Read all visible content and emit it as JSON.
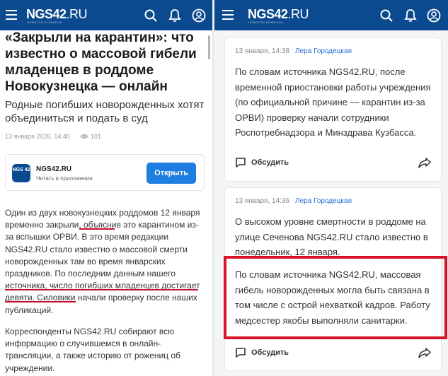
{
  "left": {
    "header": {
      "logo_main": "NGS42",
      "logo_ru": ".RU",
      "logo_sub": "НОВОСТИ КУЗБАССА"
    },
    "article": {
      "title": "«Закрыли на карантин»: что известно о массовой гибели младенцев в роддоме Новокузнецка — онлайн",
      "lead": "Родные погибших новорожденных хотят объединиться и подать в суд",
      "date": "13 января 2026, 14:40",
      "views": "101",
      "app_card": {
        "logo_text": "NGS 42",
        "name": "NGS42.RU",
        "subtitle": "Читать в приложении",
        "button": "Открыть"
      },
      "para1": "Один из двух новокузнецких роддомов 12 января временно закрыли, объяснив это карантином из-за вспышки ОРВИ. В это время редакции NGS42.RU стало известно о массовой смерти новорожденных там во время январских праздников. По последним данным нашего источника, число погибших младенцев достигает девяти. Силовики начали проверку после наших публикаций.",
      "para2": "Корреспонденты NGS42.RU собирают всю информацию о случившемся в онлайн-трансляции, а также историю от рожениц об учреждении."
    }
  },
  "right": {
    "header": {
      "logo_main": "NGS42",
      "logo_ru": ".RU",
      "logo_sub": "НОВОСТИ КУЗБАССА"
    },
    "posts": [
      {
        "date": "13 января, 14:38",
        "author": "Лера Городецкая",
        "text": "По словам источника NGS42.RU, после временной приостановки работы учреждения (по официальной причине — карантин из-за ОРВИ) проверку начали сотрудники Роспотребнадзора и Минздрава Кузбасса.",
        "discuss": "Обсудить"
      },
      {
        "date": "13 января, 14:36",
        "author": "Лера Городецкая",
        "text": "О высоком уровне смертности в роддоме на улице Сеченова NGS42.RU стало известно в понедельник, 12 января.",
        "text2": "По словам источника NGS42.RU, массовая гибель новорожденных могла быть связана в том числе с острой нехваткой кадров. Работу медсестер якобы выполняли санитарки.",
        "discuss": "Обсудить"
      }
    ]
  },
  "colors": {
    "header_bg": "#0c4a8f",
    "accent_blue": "#1e7de0",
    "highlight_red": "#d8142a"
  },
  "icons": [
    "hamburger-icon",
    "search-icon",
    "bell-icon",
    "user-icon",
    "eye-icon",
    "comment-icon",
    "share-icon"
  ]
}
